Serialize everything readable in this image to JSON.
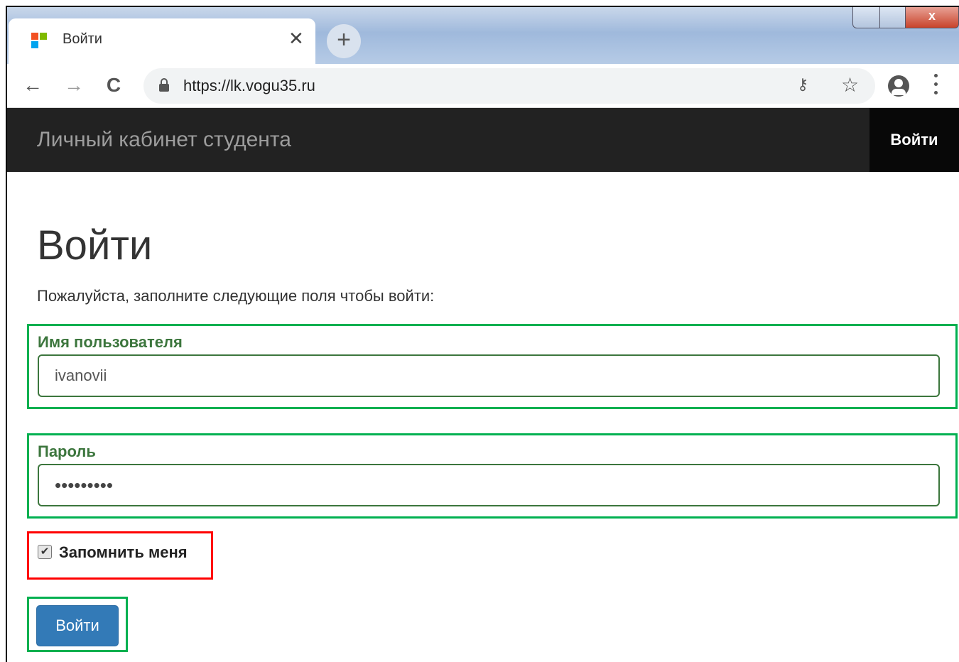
{
  "browser": {
    "tab": {
      "title": "Войти",
      "close_glyph": "✕"
    },
    "new_tab_glyph": "+",
    "close_window_glyph": "x",
    "nav": {
      "back_glyph": "←",
      "forward_glyph": "→",
      "reload_glyph": "C"
    },
    "address": {
      "url": "https://lk.vogu35.ru"
    },
    "icons": [
      "lock-icon",
      "key-icon",
      "star-icon",
      "account-icon",
      "menu-icon"
    ],
    "star_glyph": "☆",
    "key_glyph": "⚷"
  },
  "navbar": {
    "brand": "Личный кабинет студента",
    "login_link": "Войти"
  },
  "page": {
    "title": "Войти",
    "intro": "Пожалуйста, заполните следующие поля чтобы войти:"
  },
  "form": {
    "username": {
      "label": "Имя пользователя",
      "value": "ivanovii"
    },
    "password": {
      "label": "Пароль",
      "masked_value": "•••••••••"
    },
    "remember": {
      "label": "Запомнить меня",
      "checked": true,
      "check_glyph": "✔"
    },
    "submit_label": "Войти"
  },
  "annotation_colors": {
    "highlight_green": "#00b050",
    "highlight_red": "#ff0000"
  }
}
